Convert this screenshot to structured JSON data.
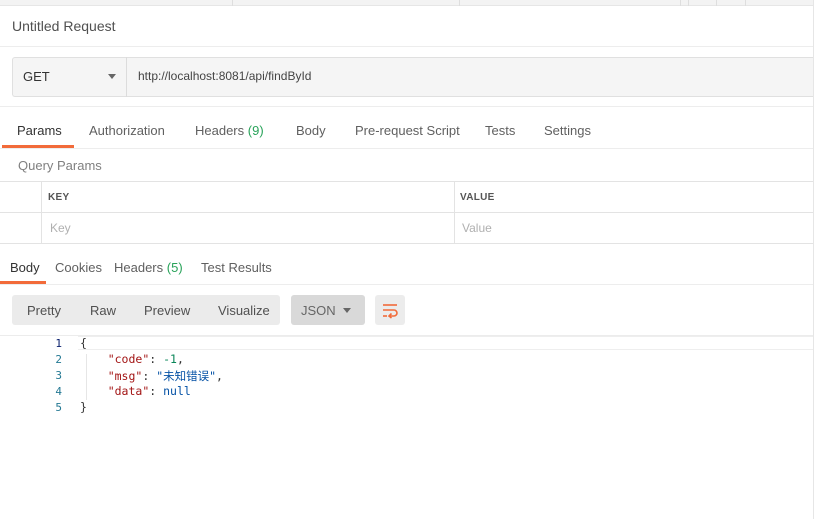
{
  "request": {
    "title": "Untitled Request",
    "method": "GET",
    "url": "http://localhost:8081/api/findById"
  },
  "request_tabs": [
    {
      "label": "Params",
      "active": true
    },
    {
      "label": "Authorization"
    },
    {
      "label": "Headers",
      "count": "(9)"
    },
    {
      "label": "Body"
    },
    {
      "label": "Pre-request Script"
    },
    {
      "label": "Tests"
    },
    {
      "label": "Settings"
    }
  ],
  "params": {
    "title": "Query Params",
    "columns": [
      "KEY",
      "VALUE"
    ],
    "key_placeholder": "Key",
    "value_placeholder": "Value"
  },
  "response_tabs": [
    {
      "label": "Body",
      "active": true
    },
    {
      "label": "Cookies"
    },
    {
      "label": "Headers",
      "count": "(5)"
    },
    {
      "label": "Test Results"
    }
  ],
  "view_modes": [
    "Pretty",
    "Raw",
    "Preview",
    "Visualize"
  ],
  "format": "JSON",
  "response_body": {
    "line_numbers": [
      "1",
      "2",
      "3",
      "4",
      "5"
    ],
    "open_brace": "{",
    "close_brace": "}",
    "fields": [
      {
        "key": "\"code\"",
        "sep": ": ",
        "value": "-1",
        "trail": ","
      },
      {
        "key": "\"msg\"",
        "sep": ": ",
        "value": "\"未知错误\"",
        "trail": ","
      },
      {
        "key": "\"data\"",
        "sep": ": ",
        "value": "null",
        "trail": ""
      }
    ]
  },
  "colors": {
    "accent": "#f26b3a",
    "count_green": "#29a35a",
    "line_number": "#237893",
    "json_key": "#a31515",
    "json_number": "#098658",
    "json_string": "#0451a5"
  }
}
